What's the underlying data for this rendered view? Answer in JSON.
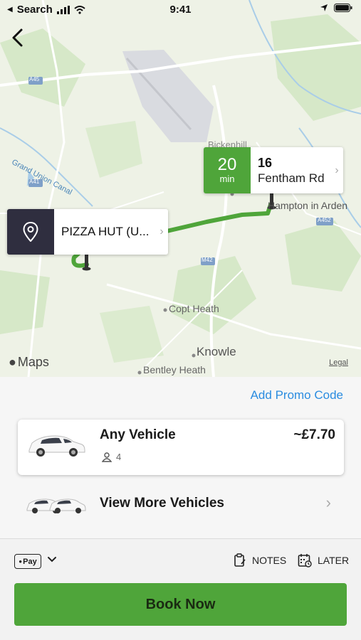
{
  "status_bar": {
    "back_app": "Search",
    "time": "9:41"
  },
  "map": {
    "pickup": {
      "label": "PIZZA HUT (U...",
      "icon": "location-pin-icon"
    },
    "destination": {
      "eta_value": "20",
      "eta_unit": "min",
      "number": "16",
      "street": "Fentham Rd"
    },
    "place_labels": {
      "canal": "Grand Union Canal",
      "hampton": "Hampton in Arden",
      "copt_heath": "Copt Heath",
      "knowle": "Knowle",
      "bentley_heath": "Bentley Heath",
      "bickenhill": "Bickenhill",
      "a45": "A45",
      "a41": "A41",
      "m42": "M42",
      "a452": "A452"
    },
    "attribution": "Maps",
    "legal": "Legal",
    "route_color": "#4fa53a"
  },
  "booking": {
    "promo_link": "Add Promo Code",
    "vehicle": {
      "name": "Any Vehicle",
      "price": "~£7.70",
      "seats": "4"
    },
    "more_vehicles": "View More Vehicles"
  },
  "footer": {
    "payment_badge": "Pay",
    "notes": "NOTES",
    "later": "LATER",
    "book_now": "Book Now"
  },
  "colors": {
    "accent_green": "#4fa53a",
    "link_blue": "#2a8ce0",
    "pin_dark": "#2f2e3f"
  }
}
